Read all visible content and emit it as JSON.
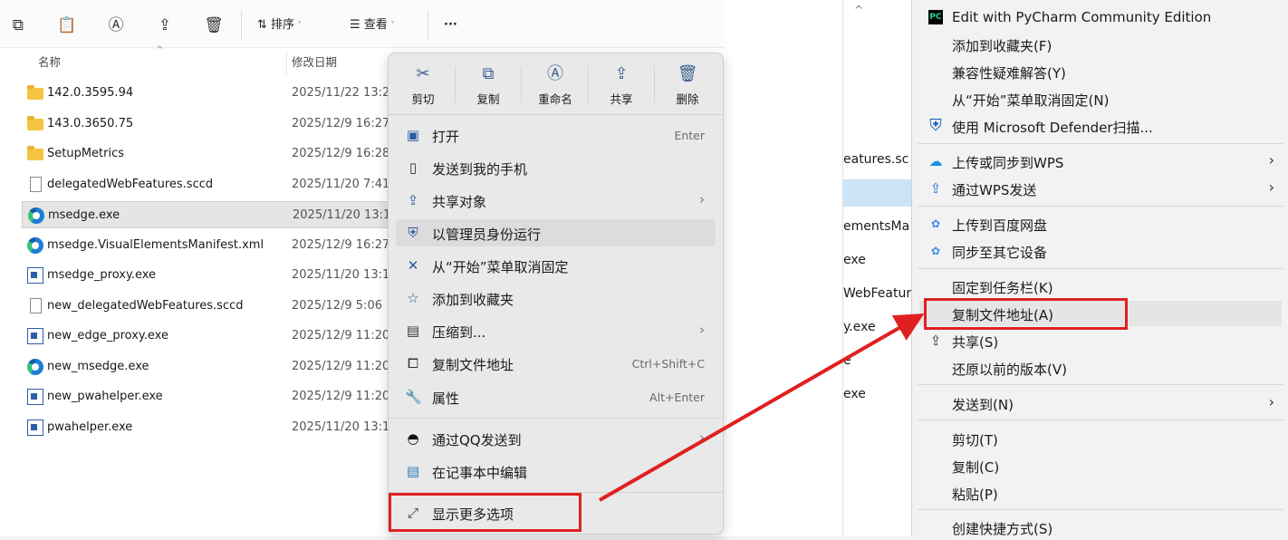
{
  "toolbar": {
    "sort_label": "排序",
    "view_label": "查看",
    "more_label": "···"
  },
  "columns": {
    "name": "名称",
    "modified": "修改日期"
  },
  "files": [
    {
      "name": "142.0.3595.94",
      "date": "2025/11/22 13:2",
      "icon": "folder-icon"
    },
    {
      "name": "143.0.3650.75",
      "date": "2025/12/9 16:27",
      "icon": "folder-icon"
    },
    {
      "name": "SetupMetrics",
      "date": "2025/12/9 16:28",
      "icon": "folder-icon"
    },
    {
      "name": "delegatedWebFeatures.sccd",
      "date": "2025/11/20 7:41",
      "icon": "document-icon"
    },
    {
      "name": "msedge.exe",
      "date": "2025/11/20 13:1",
      "icon": "edge-icon"
    },
    {
      "name": "msedge.VisualElementsManifest.xml",
      "date": "2025/12/9 16:27",
      "icon": "edge-icon"
    },
    {
      "name": "msedge_proxy.exe",
      "date": "2025/11/20 13:1",
      "icon": "app-icon"
    },
    {
      "name": "new_delegatedWebFeatures.sccd",
      "date": "2025/12/9 5:06",
      "icon": "document-icon"
    },
    {
      "name": "new_edge_proxy.exe",
      "date": "2025/12/9 11:20",
      "icon": "app-icon"
    },
    {
      "name": "new_msedge.exe",
      "date": "2025/12/9 11:20",
      "icon": "edge-icon"
    },
    {
      "name": "new_pwahelper.exe",
      "date": "2025/12/9 11:20",
      "icon": "app-icon"
    },
    {
      "name": "pwahelper.exe",
      "date": "2025/11/20 13:1",
      "icon": "app-icon"
    }
  ],
  "context_menu": {
    "quick_actions": [
      "剪切",
      "复制",
      "重命名",
      "共享",
      "删除"
    ],
    "items": [
      {
        "label": "打开",
        "shortcut": "Enter"
      },
      {
        "label": "发送到我的手机",
        "shortcut": ""
      },
      {
        "label": "共享对象",
        "shortcut": ""
      },
      {
        "label": "以管理员身份运行",
        "shortcut": ""
      },
      {
        "label": "从“开始”菜单取消固定",
        "shortcut": ""
      },
      {
        "label": "添加到收藏夹",
        "shortcut": ""
      },
      {
        "label": "压缩到...",
        "shortcut": ""
      },
      {
        "label": "复制文件地址",
        "shortcut": "Ctrl+Shift+C"
      },
      {
        "label": "属性",
        "shortcut": "Alt+Enter"
      },
      {
        "label": "通过QQ发送到",
        "shortcut": ""
      },
      {
        "label": "在记事本中编辑",
        "shortcut": ""
      },
      {
        "label": "显示更多选项",
        "shortcut": ""
      }
    ]
  },
  "background_strip": [
    "eatures.sc",
    "ementsMa",
    "exe",
    "WebFeatur",
    "y.exe",
    "e",
    "exe"
  ],
  "classic_menu": {
    "items": [
      "Edit with PyCharm Community Edition",
      "添加到收藏夹(F)",
      "兼容性疑难解答(Y)",
      "从“开始”菜单取消固定(N)",
      "使用 Microsoft Defender扫描...",
      "上传或同步到WPS",
      "通过WPS发送",
      "上传到百度网盘",
      "同步至其它设备",
      "固定到任务栏(K)",
      "复制文件地址(A)",
      "共享(S)",
      "还原以前的版本(V)",
      "发送到(N)",
      "剪切(T)",
      "复制(C)",
      "粘贴(P)",
      "创建快捷方式(S)"
    ]
  },
  "colors": {
    "highlight_red": "#e02020",
    "accent": "#2a5aa0"
  }
}
